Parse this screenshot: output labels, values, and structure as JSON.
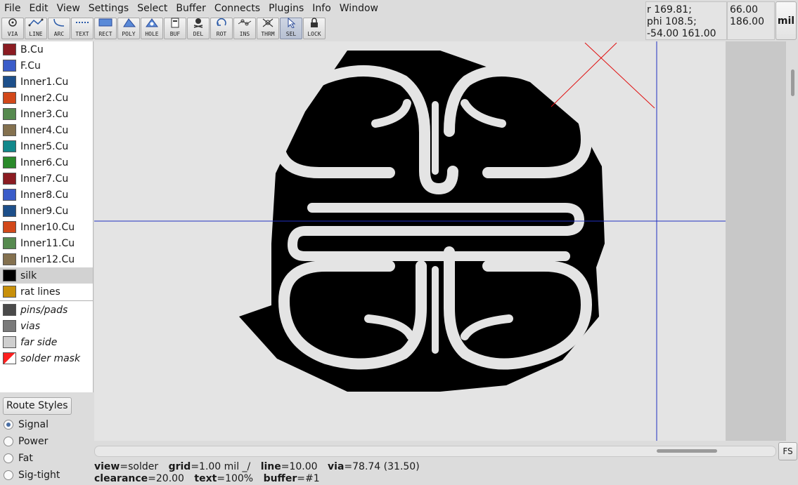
{
  "menubar": {
    "items": [
      "File",
      "Edit",
      "View",
      "Settings",
      "Select",
      "Buffer",
      "Connects",
      "Plugins",
      "Info",
      "Window"
    ]
  },
  "toolbar": {
    "tools": [
      {
        "label": "VIA",
        "icon": "via-icon"
      },
      {
        "label": "LINE",
        "icon": "line-icon"
      },
      {
        "label": "ARC",
        "icon": "arc-icon"
      },
      {
        "label": "TEXT",
        "icon": "text-icon"
      },
      {
        "label": "RECT",
        "icon": "rect-icon"
      },
      {
        "label": "POLY",
        "icon": "poly-icon"
      },
      {
        "label": "HOLE",
        "icon": "hole-icon"
      },
      {
        "label": "BUF",
        "icon": "buffer-icon"
      },
      {
        "label": "DEL",
        "icon": "delete-icon"
      },
      {
        "label": "ROT",
        "icon": "rotate-icon"
      },
      {
        "label": "INS",
        "icon": "insert-icon"
      },
      {
        "label": "THRM",
        "icon": "thermal-icon"
      },
      {
        "label": "SEL",
        "icon": "select-icon",
        "active": true
      },
      {
        "label": "LOCK",
        "icon": "lock-icon"
      }
    ]
  },
  "coords": {
    "polar_r": "r 169.81;",
    "polar_phi": "phi 108.5;",
    "rel": "-54.00 161.00",
    "abs_x": "66.00",
    "abs_y": "186.00",
    "unit": "mil"
  },
  "layers": [
    {
      "label": "B.Cu",
      "color": "#8b1c22"
    },
    {
      "label": "F.Cu",
      "color": "#3a5cc9"
    },
    {
      "label": "Inner1.Cu",
      "color": "#1d4f8a"
    },
    {
      "label": "Inner2.Cu",
      "color": "#d2481a"
    },
    {
      "label": "Inner3.Cu",
      "color": "#568a4f"
    },
    {
      "label": "Inner4.Cu",
      "color": "#84714f"
    },
    {
      "label": "Inner5.Cu",
      "color": "#12888b"
    },
    {
      "label": "Inner6.Cu",
      "color": "#2a8a2a"
    },
    {
      "label": "Inner7.Cu",
      "color": "#8b1c22"
    },
    {
      "label": "Inner8.Cu",
      "color": "#3a5cc9"
    },
    {
      "label": "Inner9.Cu",
      "color": "#1d4f8a"
    },
    {
      "label": "Inner10.Cu",
      "color": "#d2481a"
    },
    {
      "label": "Inner11.Cu",
      "color": "#568a4f"
    },
    {
      "label": "Inner12.Cu",
      "color": "#84714f"
    },
    {
      "label": "silk",
      "color": "#000000",
      "selected": true
    },
    {
      "label": "rat lines",
      "color": "#c8900a"
    }
  ],
  "virtual_layers": [
    {
      "label": "pins/pads",
      "color": "#4a4a4a"
    },
    {
      "label": "vias",
      "color": "#7a7a7a"
    },
    {
      "label": "far side",
      "color": "#cfcfcf"
    },
    {
      "label": "solder mask",
      "color": "#ff2020"
    }
  ],
  "route_styles": {
    "button_label": "Route Styles",
    "options": [
      {
        "label": "Signal",
        "checked": true
      },
      {
        "label": "Power",
        "checked": false
      },
      {
        "label": "Fat",
        "checked": false
      },
      {
        "label": "Sig-tight",
        "checked": false
      }
    ]
  },
  "fs_label": "FS",
  "status": {
    "view_key": "view",
    "view_val": "=solder",
    "grid_key": "grid",
    "grid_val": "=1.00 mil  _/",
    "line_key": "line",
    "line_val": "=10.00",
    "via_key": "via",
    "via_val": "=78.74 (31.50)",
    "clearance_key": "clearance",
    "clearance_val": "=20.00",
    "text_key": "text",
    "text_val": "=100%",
    "buffer_key": "buffer",
    "buffer_val": "=#1"
  },
  "colors": {
    "crosshair": "#1f2fbf",
    "cursor_marker": "#e01010",
    "artwork": "#000000",
    "canvas_bg": "#e4e4e4"
  }
}
